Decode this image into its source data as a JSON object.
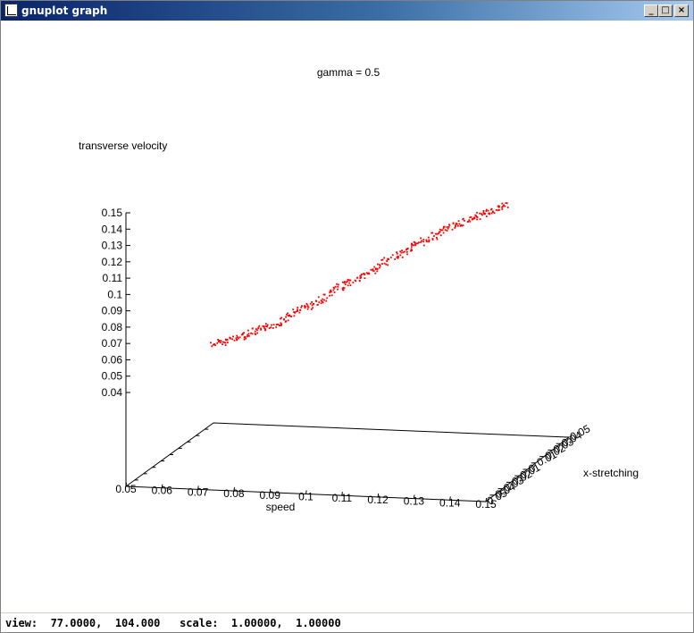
{
  "window": {
    "title": "gnuplot graph",
    "controls": {
      "minimize": "_",
      "maximize": "□",
      "close": "×"
    }
  },
  "status_text": "view:  77.0000,  104.000   scale:  1.00000,  1.00000",
  "chart_data": {
    "type": "scatter",
    "title": "gamma = 0.5",
    "xlabel": "speed",
    "ylabel": "x-stretching",
    "zlabel": "transverse velocity",
    "xlim": [
      0.05,
      0.15
    ],
    "ylim": [
      0.04,
      0.05
    ],
    "zlim": [
      0.04,
      0.15
    ],
    "view": {
      "rot_x": 77.0,
      "rot_z": 104.0,
      "scale": 1.0,
      "scale_z": 1.0
    },
    "x_ticks": [
      "0.05",
      "0.06",
      "0.07",
      "0.08",
      "0.09",
      "0.1",
      "0.11",
      "0.12",
      "0.13",
      "0.14",
      "0.15"
    ],
    "y_ticks": [
      "0.05",
      "0.04",
      "0.03",
      "0.02",
      "0.01",
      "0",
      "0.01",
      "0.02",
      "0.03",
      "0.04",
      "0.05"
    ],
    "z_ticks": [
      "0.15",
      "0.14",
      "0.13",
      "0.12",
      "0.11",
      "0.1",
      "0.09",
      "0.08",
      "0.07",
      "0.06",
      "0.05",
      "0.04"
    ],
    "series": [
      {
        "color": "#ff0000",
        "marker": "dot",
        "points": [
          {
            "x": 0.066,
            "z": 0.07
          },
          {
            "x": 0.072,
            "z": 0.073
          },
          {
            "x": 0.078,
            "z": 0.077
          },
          {
            "x": 0.084,
            "z": 0.081
          },
          {
            "x": 0.09,
            "z": 0.088
          },
          {
            "x": 0.096,
            "z": 0.093
          },
          {
            "x": 0.102,
            "z": 0.101
          },
          {
            "x": 0.108,
            "z": 0.106
          },
          {
            "x": 0.114,
            "z": 0.113
          },
          {
            "x": 0.12,
            "z": 0.12
          },
          {
            "x": 0.126,
            "z": 0.126
          },
          {
            "x": 0.132,
            "z": 0.132
          },
          {
            "x": 0.138,
            "z": 0.137
          },
          {
            "x": 0.144,
            "z": 0.141
          },
          {
            "x": 0.15,
            "z": 0.146
          }
        ]
      }
    ]
  }
}
